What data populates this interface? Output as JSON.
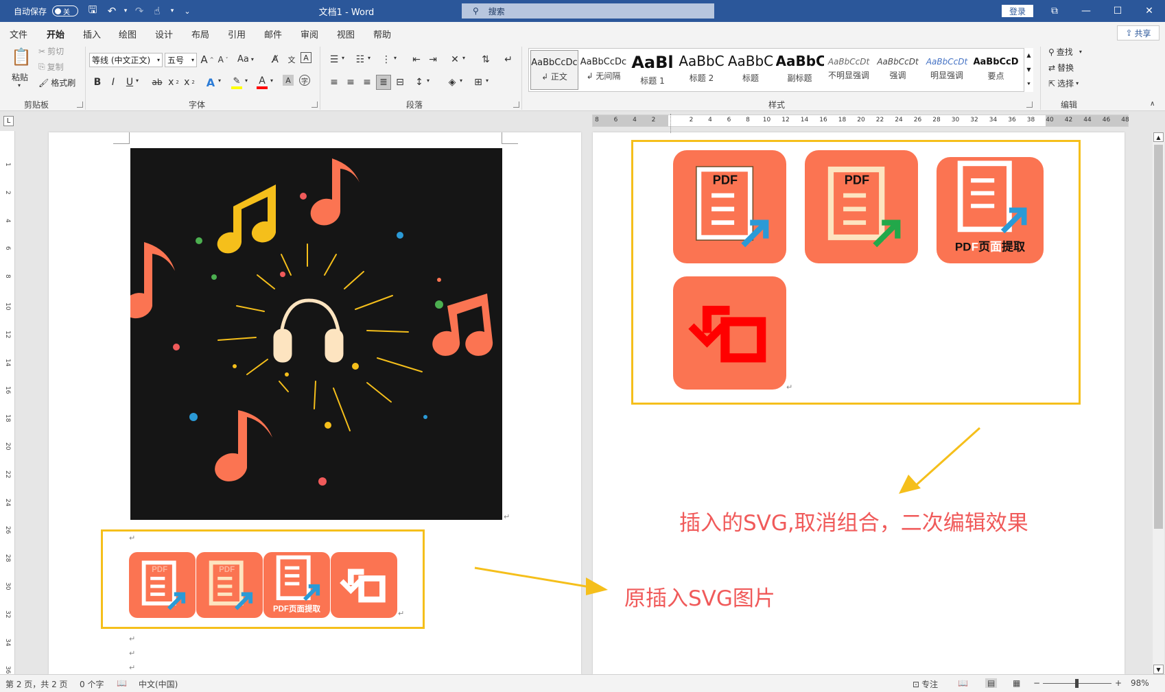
{
  "titlebar": {
    "autosave_label": "自动保存",
    "autosave_state": "关",
    "doc_title": "文档1  -  Word",
    "search_placeholder": "搜索",
    "login_label": "登录"
  },
  "menu": {
    "tabs": [
      "文件",
      "开始",
      "插入",
      "绘图",
      "设计",
      "布局",
      "引用",
      "邮件",
      "审阅",
      "视图",
      "帮助"
    ],
    "active_tab": "开始",
    "share_label": "共享"
  },
  "ribbon": {
    "clipboard": {
      "paste": "粘贴",
      "cut": "剪切",
      "copy": "复制",
      "format_painter": "格式刷",
      "label": "剪贴板"
    },
    "font": {
      "font_name": "等线 (中文正文)",
      "font_size": "五号",
      "grow": "A",
      "shrink": "A",
      "change_case": "Aa",
      "label": "字体",
      "bold": "B",
      "italic": "I",
      "underline": "U",
      "strike": "ab",
      "subscript": "x",
      "superscript": "x",
      "highlight_color": "#ffff00",
      "font_color": "#ff0000"
    },
    "paragraph": {
      "label": "段落"
    },
    "styles": {
      "label": "样式",
      "items": [
        {
          "preview": "AaBbCcDc",
          "name": "↲ 正文",
          "size": "13px",
          "weight": "normal",
          "color": "#222",
          "italic": false,
          "selected": true
        },
        {
          "preview": "AaBbCcDc",
          "name": "↲ 无间隔",
          "size": "13px",
          "weight": "normal",
          "color": "#222",
          "italic": false,
          "selected": false
        },
        {
          "preview": "AaBl",
          "name": "标题 1",
          "size": "24px",
          "weight": "bold",
          "color": "#111",
          "italic": false,
          "selected": false
        },
        {
          "preview": "AaBbC",
          "name": "标题 2",
          "size": "20px",
          "weight": "normal",
          "color": "#111",
          "italic": false,
          "selected": false
        },
        {
          "preview": "AaBbC",
          "name": "标题",
          "size": "20px",
          "weight": "normal",
          "color": "#111",
          "italic": false,
          "selected": false
        },
        {
          "preview": "AaBbC",
          "name": "副标题",
          "size": "20px",
          "weight": "bold",
          "color": "#111",
          "italic": false,
          "selected": false
        },
        {
          "preview": "AaBbCcDt",
          "name": "不明显强调",
          "size": "12px",
          "weight": "normal",
          "color": "#666",
          "italic": true,
          "selected": false
        },
        {
          "preview": "AaBbCcDt",
          "name": "强调",
          "size": "12px",
          "weight": "normal",
          "color": "#444",
          "italic": true,
          "selected": false
        },
        {
          "preview": "AaBbCcDt",
          "name": "明显强调",
          "size": "12px",
          "weight": "normal",
          "color": "#4472c4",
          "italic": true,
          "selected": false
        },
        {
          "preview": "AaBbCcD",
          "name": "要点",
          "size": "13px",
          "weight": "bold",
          "color": "#111",
          "italic": false,
          "selected": false
        }
      ]
    },
    "editing": {
      "find": "查找",
      "replace": "替换",
      "select": "选择",
      "label": "编辑"
    }
  },
  "ruler": {
    "horizontal": [
      "8",
      "6",
      "4",
      "2",
      "",
      "2",
      "4",
      "6",
      "8",
      "10",
      "12",
      "14",
      "16",
      "18",
      "20",
      "22",
      "24",
      "26",
      "28",
      "30",
      "32",
      "34",
      "36",
      "38",
      "40",
      "42",
      "44",
      "46",
      "48"
    ],
    "vertical": [
      "1",
      "2",
      "4",
      "6",
      "8",
      "10",
      "12",
      "14",
      "16",
      "18",
      "20",
      "22",
      "24",
      "26",
      "28",
      "30",
      "32",
      "34",
      "36"
    ]
  },
  "document": {
    "annotation_1": "插入的SVG,取消组合，二次编辑效果",
    "annotation_2": "原插入SVG图片",
    "icon_pdf_label": "PDF",
    "icon_extract_label": "PDF页面提取",
    "icon_extract_parts": [
      "PD",
      "F",
      "页",
      "面",
      "提取"
    ],
    "arrow_color": "#f5bf1b",
    "icon_color": "#fb7452"
  },
  "statusbar": {
    "page": "第 2 页，共 2 页",
    "words": "0 个字",
    "language": "中文(中国)",
    "focus": "专注",
    "zoom": "98%"
  }
}
